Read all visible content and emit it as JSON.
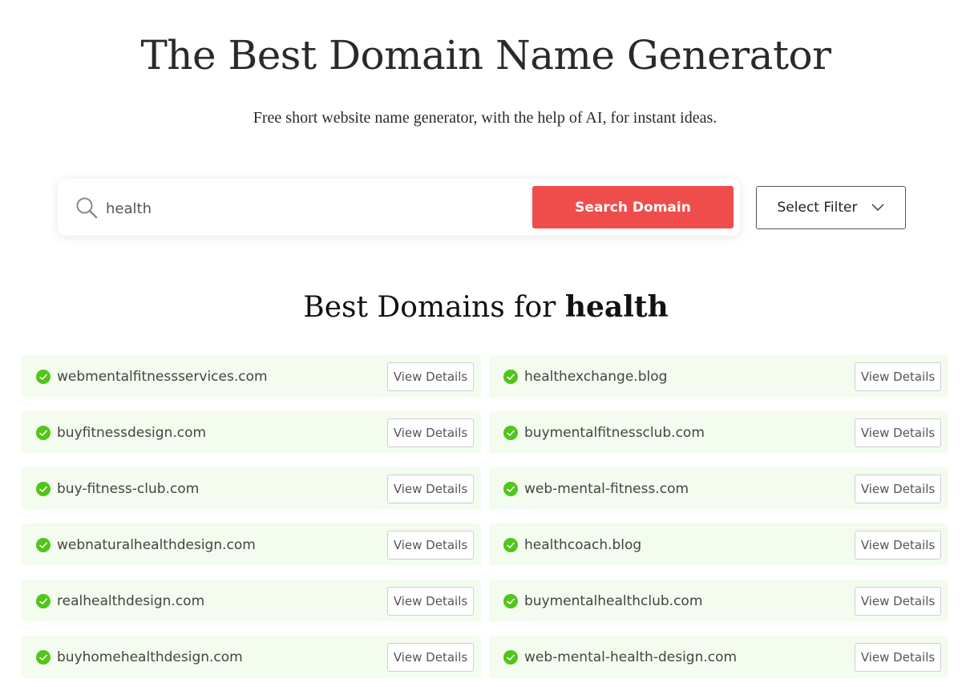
{
  "header": {
    "title": "The Best Domain Name Generator",
    "subtitle": "Free short website name generator, with the help of AI, for instant ideas."
  },
  "search": {
    "value": "health",
    "icon": "search-icon",
    "button_label": "Search Domain",
    "button_color": "#ef4d4b"
  },
  "filter": {
    "label": "Select Filter",
    "icon": "chevron-down-icon"
  },
  "results": {
    "heading_prefix": "Best Domains for ",
    "heading_keyword": "health",
    "available_color": "#52c41a",
    "view_label": "View Details",
    "items": [
      {
        "domain": "webmentalfitnessservices.com"
      },
      {
        "domain": "healthexchange.blog"
      },
      {
        "domain": "buyfitnessdesign.com"
      },
      {
        "domain": "buymentalfitnessclub.com"
      },
      {
        "domain": "buy-fitness-club.com"
      },
      {
        "domain": "web-mental-fitness.com"
      },
      {
        "domain": "webnaturalhealthdesign.com"
      },
      {
        "domain": "healthcoach.blog"
      },
      {
        "domain": "realhealthdesign.com"
      },
      {
        "domain": "buymentalhealthclub.com"
      },
      {
        "domain": "buyhomehealthdesign.com"
      },
      {
        "domain": "web-mental-health-design.com"
      }
    ]
  }
}
